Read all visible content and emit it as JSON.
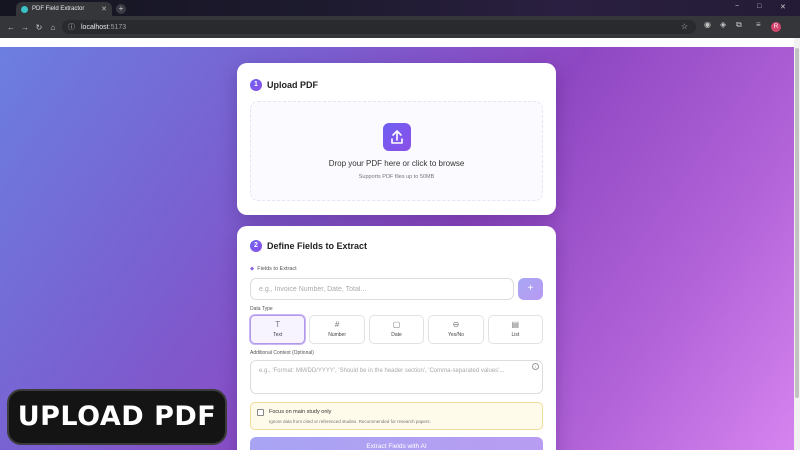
{
  "browser": {
    "tab_title": "PDF Field Extractor",
    "new_tab": "+",
    "url_host": "localhost",
    "url_port": ":5173",
    "profile_initial": "R",
    "window_controls": [
      "−",
      "□",
      "✕"
    ]
  },
  "upload": {
    "step": "1",
    "title": "Upload PDF",
    "drop_main": "Drop your PDF here or click to browse",
    "drop_sub": "Supports PDF files up to 50MB"
  },
  "define": {
    "step": "2",
    "title": "Define Fields to Extract",
    "fields_label": "Fields to Extract",
    "field_placeholder": "e.g., Invoice Number, Date, Total...",
    "add_label": "+",
    "data_type_label": "Data Type",
    "data_types": [
      {
        "label": "Text",
        "icon": "T"
      },
      {
        "label": "Number",
        "icon": "#"
      },
      {
        "label": "Date",
        "icon": "▢"
      },
      {
        "label": "Yes/No",
        "icon": "⊖"
      },
      {
        "label": "List",
        "icon": "▤"
      }
    ],
    "active_type": "Text",
    "context_label": "Additional Context (Optional)",
    "context_placeholder": "e.g., 'Format: MM/DD/YYYY', 'Should be in the header section', 'Comma-separated values'...",
    "focus_title": "Focus on main study only",
    "focus_sub": "Ignore data from cited or referenced studies. Recommended for research papers.",
    "extract_label": "Extract Fields with AI"
  },
  "overlay_caption": "UPLOAD PDF",
  "colors": {
    "accent": "#6e60f2",
    "accent_light": "#b79af2",
    "background_start": "#6b7fe0",
    "background_end": "#d684ef"
  }
}
